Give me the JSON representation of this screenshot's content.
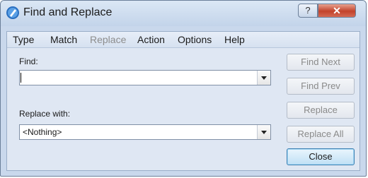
{
  "window": {
    "title": "Find and Replace"
  },
  "title_controls": {
    "help": "?",
    "close": "✕"
  },
  "menu": [
    "Type",
    "Match",
    "Replace",
    "Action",
    "Options",
    "Help"
  ],
  "find": {
    "label": "Find:",
    "value": ""
  },
  "replace": {
    "label": "Replace with:",
    "value": "<Nothing>"
  },
  "buttons": {
    "find_next": "Find Next",
    "find_prev": "Find Prev",
    "replace": "Replace",
    "replace_all": "Replace All",
    "close": "Close"
  },
  "icons": {
    "app": "pen-icon",
    "dropdown": "chevron-down-icon"
  },
  "colors": {
    "accent": "#3c7fb1",
    "close": "#c2422b"
  }
}
